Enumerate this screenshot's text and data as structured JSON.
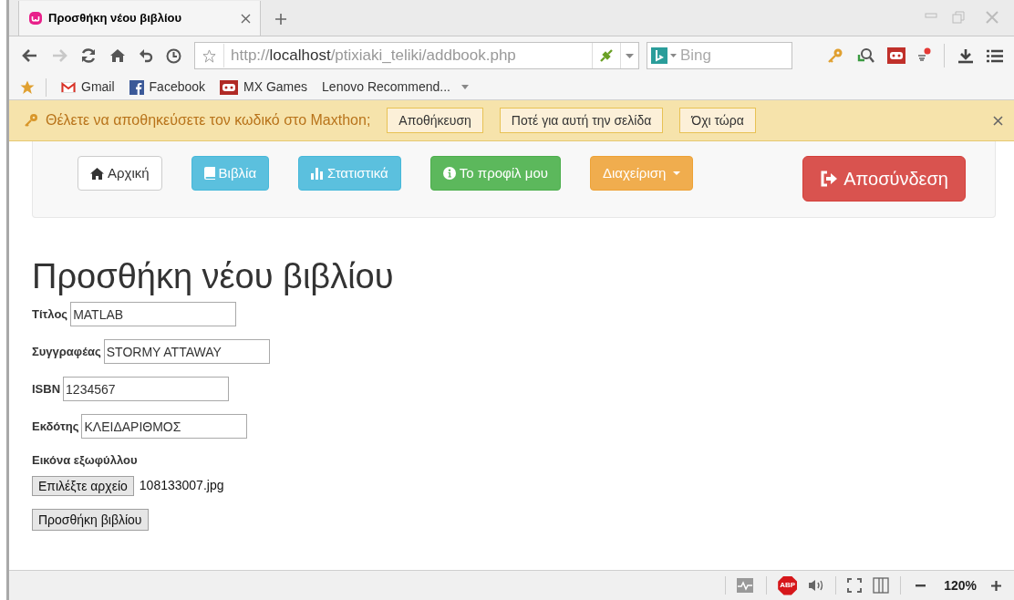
{
  "browser": {
    "tab": {
      "title": "Προσθήκη νέου βιβλίου",
      "selected": true
    },
    "address": {
      "scheme": "http://",
      "host": "localhost",
      "path": "/ptixiaki_teliki/addbook.php"
    },
    "search": {
      "placeholder": "Bing"
    },
    "bookmarks": [
      {
        "kind": "gmail",
        "label": "Gmail"
      },
      {
        "kind": "facebook",
        "label": "Facebook"
      },
      {
        "kind": "games",
        "label": "MX Games"
      },
      {
        "kind": "folder",
        "label": "Lenovo Recommend..."
      }
    ],
    "password_bar": {
      "message": "Θέλετε να αποθηκεύσετε τον κωδικό στο Maxthon;",
      "buttons": [
        "Αποθήκευση",
        "Ποτέ για αυτή την σελίδα",
        "Όχι τώρα"
      ]
    },
    "status_bar": {
      "abp": "ABP",
      "zoom": "120%"
    }
  },
  "navbar": {
    "buttons": [
      {
        "kind": "default",
        "label": "Αρχική"
      },
      {
        "kind": "info",
        "label": "Βιβλία"
      },
      {
        "kind": "info",
        "label": "Στατιστικά"
      },
      {
        "kind": "success",
        "label": "Το προφίλ μου"
      },
      {
        "kind": "warning",
        "label": "Διαχείριση",
        "dropdown": true
      }
    ],
    "logout": {
      "kind": "danger",
      "label": "Αποσύνδεση"
    }
  },
  "form": {
    "heading": "Προσθήκη νέου βιβλίου",
    "fields": [
      {
        "label": "Τίτλος",
        "value": "MATLAB"
      },
      {
        "label": "Συγγραφέας",
        "value": "STORMY ATTAWAY"
      },
      {
        "label": "ISBN",
        "value": "1234567"
      },
      {
        "label": "Εκδότης",
        "value": "ΚΛΕΙΔΑΡΙΘΜΟΣ"
      }
    ],
    "cover": {
      "label": "Εικόνα εξωφύλλου",
      "button": "Επιλέξτε αρχείο",
      "file": "108133007.jpg"
    },
    "submit": "Προσθήκη βιβλίου"
  }
}
